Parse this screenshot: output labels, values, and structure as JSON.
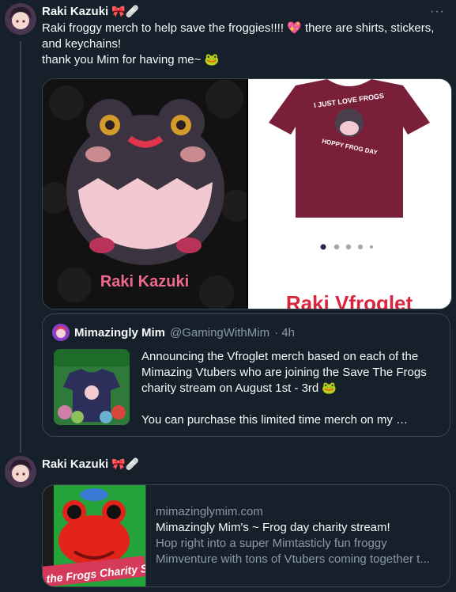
{
  "tweet1": {
    "author": "Raki Kazuki",
    "author_emojis": "🎀🩹",
    "more": "···",
    "lines": [
      "Raki froggy merch to help save the froggies!!!! 💖 there are shirts, stickers,",
      "and keychains!",
      "thank you Mim for having me~ 🐸"
    ],
    "media": {
      "left_caption": "Raki Kazuki",
      "right_shirt_top": "I JUST LOVE FROGS",
      "right_shirt_bottom": "HOPPY FROG DAY",
      "right_banner": "Raki Vfroglet",
      "carousel_dots": 5
    }
  },
  "quote": {
    "author": "Mimazingly Mim",
    "handle": "@GamingWithMim",
    "time": "· 4h",
    "lines": [
      "Announcing the Vfroglet merch based on each of the",
      "Mimazing Vtubers who are joining the Save The Frogs",
      "charity stream on August 1st - 3rd 🐸",
      "",
      "You can purchase this limited time merch on my …"
    ]
  },
  "tweet2": {
    "author": "Raki Kazuki",
    "author_emojis": "🎀🩹",
    "card": {
      "domain": "mimazinglymim.com",
      "title": "Mimazingly Mim's ~ Frog day charity stream!",
      "desc_line1": "Hop right into a super Mimtasticly fun froggy",
      "desc_line2": "Mimventure with tons of Vtubers coming together t...",
      "thumb_text": "the Frogs Charity S"
    }
  }
}
